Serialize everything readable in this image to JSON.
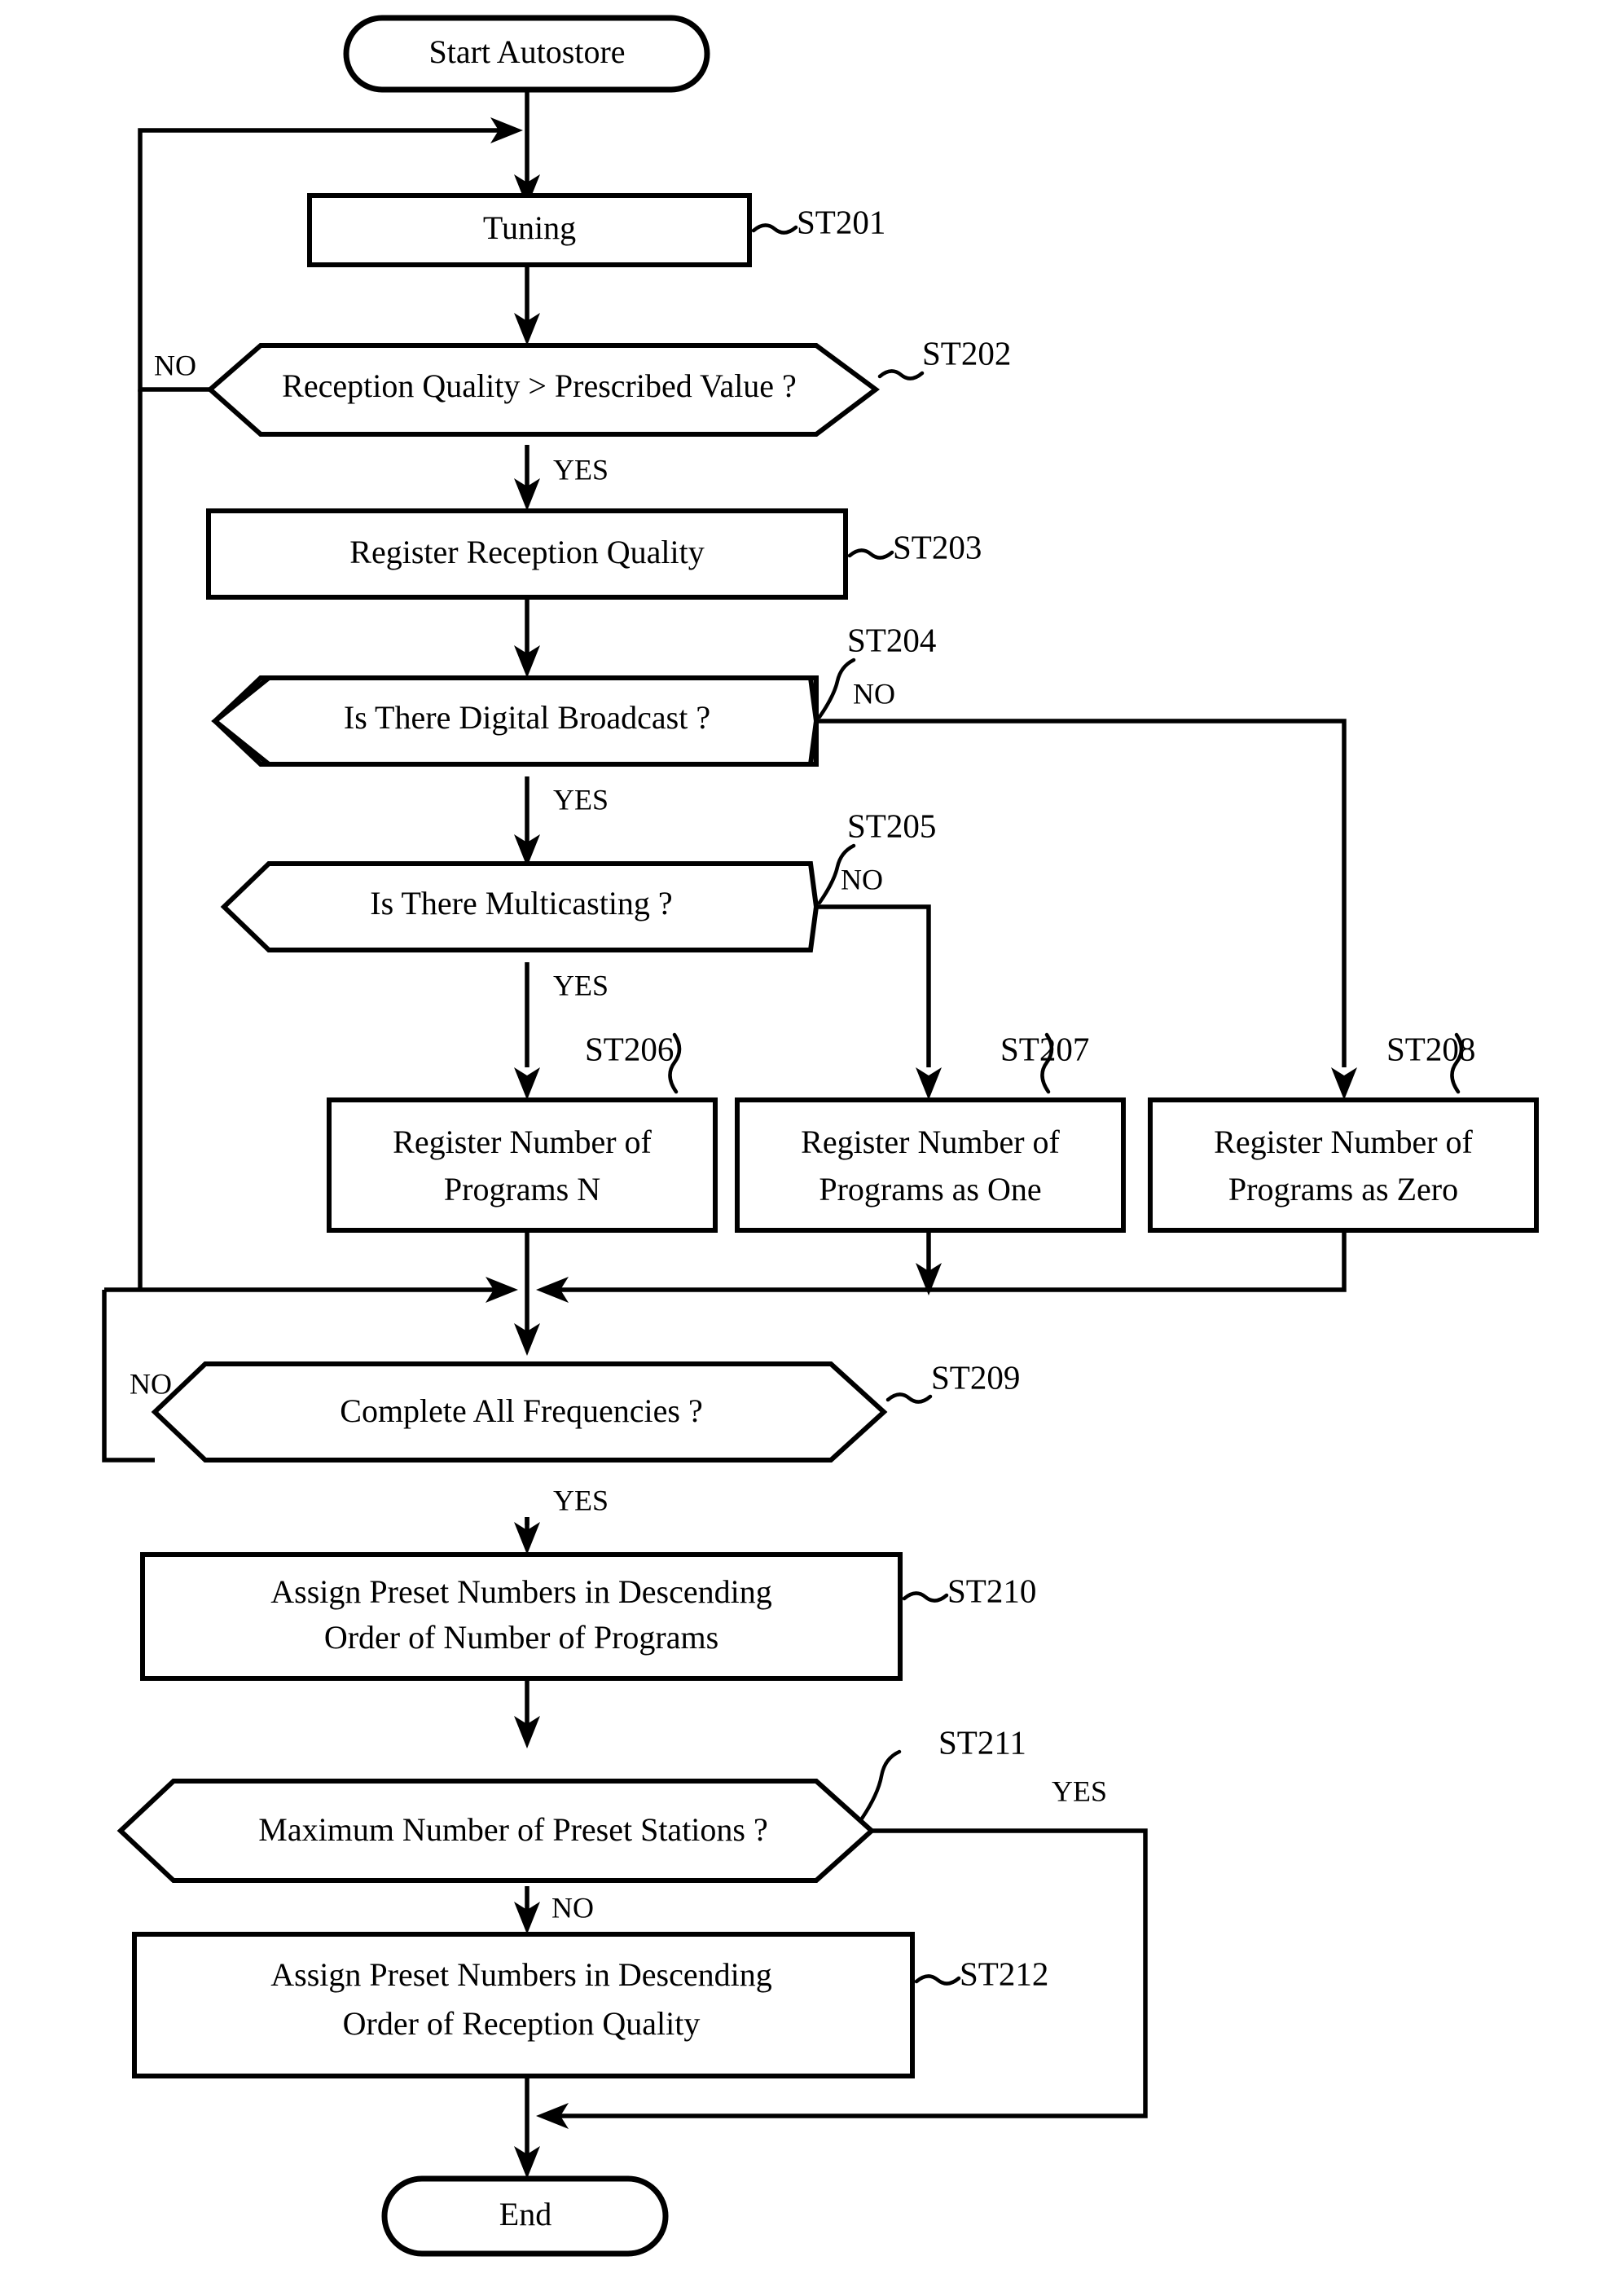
{
  "diagram": {
    "type": "flowchart",
    "title_text": "Autostore Preset Assignment Flowchart",
    "orientation": "top-to-bottom",
    "nodes": [
      {
        "id": "start",
        "shape": "terminator",
        "label": "Start Autostore",
        "ref": ""
      },
      {
        "id": "st201",
        "shape": "process",
        "label": "Tuning",
        "ref": "ST201"
      },
      {
        "id": "st202",
        "shape": "decision",
        "label": "Reception Quality > Prescribed Value ?",
        "ref": "ST202"
      },
      {
        "id": "st203",
        "shape": "process",
        "label": "Register Reception Quality",
        "ref": "ST203"
      },
      {
        "id": "st204",
        "shape": "decision",
        "label": "Is There Digital Broadcast ?",
        "ref": "ST204"
      },
      {
        "id": "st205",
        "shape": "decision",
        "label": "Is There Multicasting ?",
        "ref": "ST205"
      },
      {
        "id": "st206",
        "shape": "process",
        "label_line1": "Register Number of",
        "label_line2": "Programs N",
        "ref": "ST206"
      },
      {
        "id": "st207",
        "shape": "process",
        "label_line1": "Register Number of",
        "label_line2": "Programs as One",
        "ref": "ST207"
      },
      {
        "id": "st208",
        "shape": "process",
        "label_line1": "Register Number of",
        "label_line2": "Programs as Zero",
        "ref": "ST208"
      },
      {
        "id": "st209",
        "shape": "decision",
        "label": "Complete All Frequencies ?",
        "ref": "ST209"
      },
      {
        "id": "st210",
        "shape": "process",
        "label_line1": "Assign Preset Numbers in Descending",
        "label_line2": "Order of Number of Programs",
        "ref": "ST210"
      },
      {
        "id": "st211",
        "shape": "decision",
        "label": "Maximum Number of Preset Stations ?",
        "ref": "ST211"
      },
      {
        "id": "st212",
        "shape": "process",
        "label_line1": "Assign Preset Numbers in Descending",
        "label_line2": "Order of Reception Quality",
        "ref": "ST212"
      },
      {
        "id": "end",
        "shape": "terminator",
        "label": "End",
        "ref": ""
      }
    ],
    "edge_labels": {
      "st202_no": "NO",
      "st202_yes": "YES",
      "st204_no": "NO",
      "st204_yes": "YES",
      "st205_no": "NO",
      "st205_yes": "YES",
      "st209_no": "NO",
      "st209_yes": "YES",
      "st211_no": "NO",
      "st211_yes": "YES"
    },
    "refs": {
      "st201": "ST201",
      "st202": "ST202",
      "st203": "ST203",
      "st204": "ST204",
      "st205": "ST205",
      "st206": "ST206",
      "st207": "ST207",
      "st208": "ST208",
      "st209": "ST209",
      "st210": "ST210",
      "st211": "ST211",
      "st212": "ST212"
    },
    "node_text": {
      "start": "Start Autostore",
      "st201": "Tuning",
      "st202": "Reception Quality > Prescribed Value ?",
      "st203": "Register Reception Quality",
      "st204": "Is There Digital Broadcast ?",
      "st205": "Is There Multicasting ?",
      "st206_l1": "Register Number of",
      "st206_l2": "Programs N",
      "st207_l1": "Register Number of",
      "st207_l2": "Programs as One",
      "st208_l1": "Register Number of",
      "st208_l2": "Programs as Zero",
      "st209": "Complete All Frequencies ?",
      "st210_l1": "Assign Preset Numbers in Descending",
      "st210_l2": "Order of Number of Programs",
      "st211": "Maximum Number of Preset Stations ?",
      "st212_l1": "Assign Preset Numbers in Descending",
      "st212_l2": "Order of Reception Quality",
      "end": "End"
    },
    "colors": {
      "stroke": "#000000",
      "fill": "#ffffff",
      "background": "#ffffff"
    }
  }
}
